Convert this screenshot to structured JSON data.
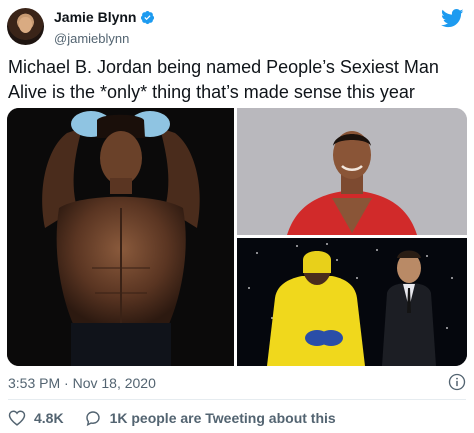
{
  "author": {
    "display_name": "Jamie Blynn",
    "handle": "@jamieblynn",
    "verified": true
  },
  "tweet": {
    "text": "Michael B. Jordan being named People’s Sexiest Man Alive is the *only* thing that’s made sense this year",
    "timestamp": "3:53 PM · Nov 18, 2020"
  },
  "actions": {
    "likes": "4.8K",
    "conversation": "1K people are Tweeting about this"
  },
  "colors": {
    "brand": "#1d9bf0",
    "like_icon": "#536471"
  }
}
